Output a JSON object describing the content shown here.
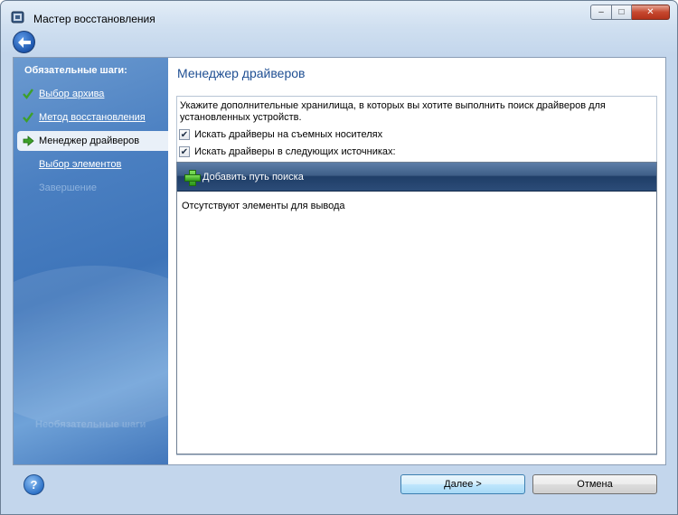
{
  "window": {
    "title": "Мастер восстановления",
    "controls": {
      "minimize": "‒",
      "maximize": "□",
      "close": "✕"
    }
  },
  "sidebar": {
    "heading": "Обязательные шаги:",
    "items": [
      {
        "label": "Выбор архива",
        "state": "done"
      },
      {
        "label": "Метод восстановления",
        "state": "done"
      },
      {
        "label": "Менеджер драйверов",
        "state": "current"
      },
      {
        "label": "Выбор элементов",
        "state": "pending"
      },
      {
        "label": "Завершение",
        "state": "disabled"
      }
    ],
    "footer": "Необязательные шаги"
  },
  "main": {
    "title": "Менеджер драйверов",
    "description": "Укажите дополнительные хранилища, в которых вы хотите выполнить поиск драйверов для установленных устройств.",
    "checkboxes": [
      {
        "label": "Искать драйверы на съемных носителях",
        "checked": true
      },
      {
        "label": "Искать драйверы в следующих источниках:",
        "checked": true
      }
    ],
    "toolbar": {
      "add_path_label": "Добавить путь поиска"
    },
    "list": {
      "empty_message": "Отсутствуют элементы для вывода"
    }
  },
  "footer": {
    "help": "?",
    "next_label": "Далее >",
    "cancel_label": "Отмена"
  },
  "icons": {
    "app": "app-icon",
    "back": "back-arrow-icon",
    "done": "checkmark-icon",
    "current": "arrow-right-icon",
    "add": "plus-icon",
    "help": "help-icon"
  },
  "colors": {
    "sidebar": "#4a7fc1",
    "title_accent": "#1f4f93",
    "toolbar": "#2c4c78",
    "check_green": "#3da02a"
  }
}
